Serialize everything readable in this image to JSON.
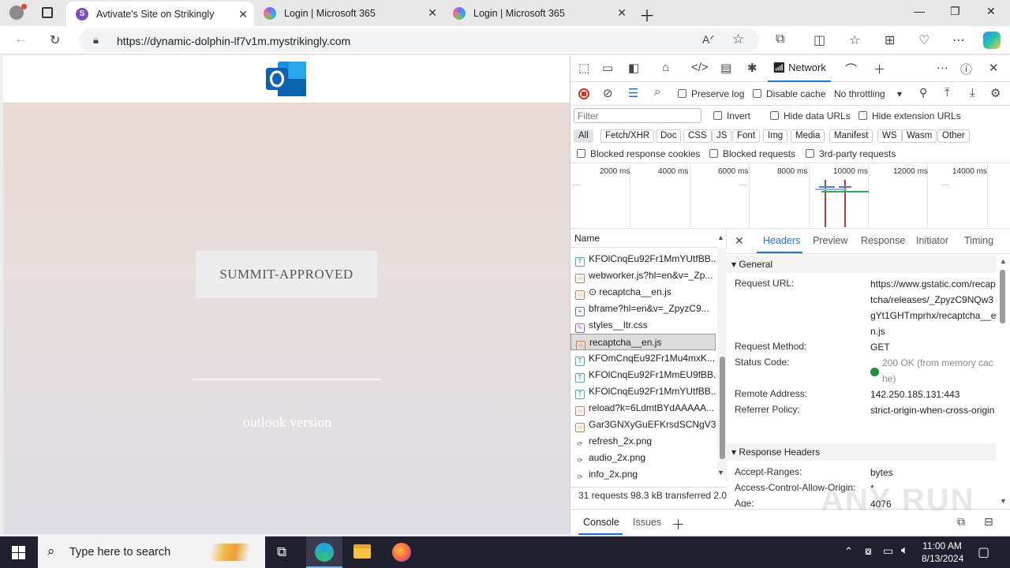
{
  "browser": {
    "tabs": [
      {
        "title": "Avtivate's Site on Strikingly",
        "favicon": "S",
        "active": true
      },
      {
        "title": "Login | Microsoft 365",
        "active": false
      },
      {
        "title": "Login | Microsoft 365",
        "active": false
      }
    ],
    "url": "https://dynamic-dolphin-lf7v1m.mystrikingly.com"
  },
  "page": {
    "button_label": "SUMMIT-APPROVED",
    "footer_text": "outlook version"
  },
  "devtools": {
    "active_tool": "Network",
    "preserve_log": "Preserve log",
    "disable_cache": "Disable cache",
    "throttling": "No throttling",
    "filter_placeholder": "Filter",
    "invert": "Invert",
    "hide_data_urls": "Hide data URLs",
    "hide_extension_urls": "Hide extension URLs",
    "type_filters": [
      "All",
      "Fetch/XHR",
      "Doc",
      "CSS",
      "JS",
      "Font",
      "Img",
      "Media",
      "Manifest",
      "WS",
      "Wasm",
      "Other"
    ],
    "blocked_response_cookies": "Blocked response cookies",
    "blocked_requests": "Blocked requests",
    "third_party": "3rd-party requests",
    "timeline_ticks": [
      "2000 ms",
      "4000 ms",
      "6000 ms",
      "8000 ms",
      "10000 ms",
      "12000 ms",
      "14000 ms"
    ],
    "name_header": "Name",
    "requests": [
      {
        "name": "KFOlCnqEu92Fr1MmYUtfBB...",
        "type": "font"
      },
      {
        "name": "webworker.js?hl=en&v=_Zp...",
        "type": "js"
      },
      {
        "name": "⊙ recaptcha__en.js",
        "type": "js"
      },
      {
        "name": "bframe?hl=en&v=_ZpyzC9...",
        "type": "doc"
      },
      {
        "name": "styles__ltr.css",
        "type": "css"
      },
      {
        "name": "recaptcha__en.js",
        "type": "js",
        "selected": true
      },
      {
        "name": "KFOmCnqEu92Fr1Mu4mxK...",
        "type": "font"
      },
      {
        "name": "KFOlCnqEu92Fr1MmEU9fBB...",
        "type": "font"
      },
      {
        "name": "KFOlCnqEu92Fr1MmYUtfBB...",
        "type": "font"
      },
      {
        "name": "reload?k=6LdmtBYdAAAAA...",
        "type": "js"
      },
      {
        "name": "Gar3GNXyGuEFKrsdSCNgV3...",
        "type": "js"
      },
      {
        "name": "refresh_2x.png",
        "type": "img"
      },
      {
        "name": "audio_2x.png",
        "type": "img"
      },
      {
        "name": "info_2x.png",
        "type": "img"
      }
    ],
    "status_summary": "31 requests  98.3 kB transferred  2.0",
    "detail_tabs": [
      "Headers",
      "Preview",
      "Response",
      "Initiator",
      "Timing"
    ],
    "general_title": "General",
    "general": [
      {
        "key": "Request URL:",
        "value": "https://www.gstatic.com/recaptcha/releases/_ZpyzC9NQw3gYt1GHTmprhx/recaptcha__en.js"
      },
      {
        "key": "Request Method:",
        "value": "GET"
      },
      {
        "key": "Status Code:",
        "value": "200 OK (from memory cache)"
      },
      {
        "key": "Remote Address:",
        "value": "142.250.185.131:443"
      },
      {
        "key": "Referrer Policy:",
        "value": "strict-origin-when-cross-origin"
      }
    ],
    "response_headers_title": "Response Headers",
    "response_headers": [
      {
        "key": "Accept-Ranges:",
        "value": "bytes"
      },
      {
        "key": "Access-Control-Allow-Origin:",
        "value": "*"
      },
      {
        "key": "Age:",
        "value": "4076"
      }
    ],
    "drawer_tabs": [
      "Console",
      "Issues"
    ]
  },
  "taskbar": {
    "search_placeholder": "Type here to search",
    "time": "11:00 AM",
    "date": "8/13/2024"
  },
  "watermark": "ANY RUN",
  "colors": {
    "accent": "#1a73e8",
    "record": "#d93025",
    "status_ok": "#1e8e3e",
    "taskbar": "#1f1f2e"
  }
}
